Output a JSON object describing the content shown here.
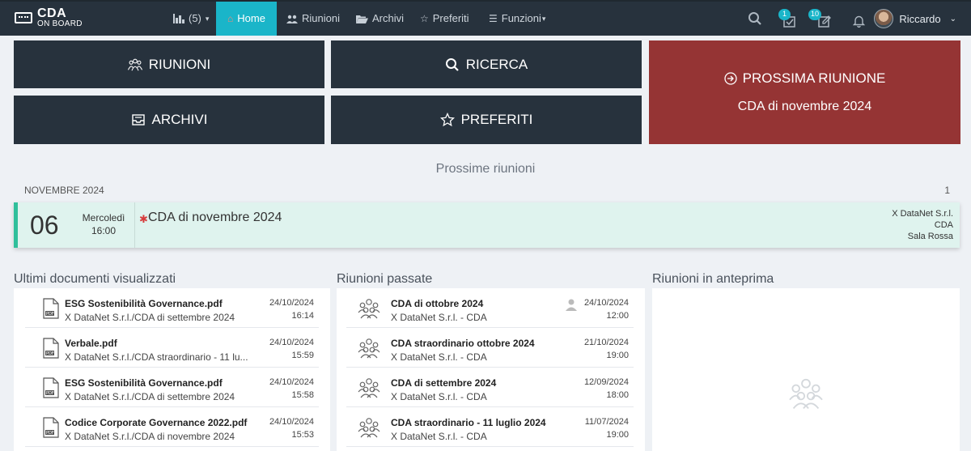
{
  "brand": {
    "line1": "CDA",
    "line2": "ON BOARD"
  },
  "nav": {
    "stats": "(5)",
    "home": "Home",
    "riunioni": "Riunioni",
    "archivi": "Archivi",
    "preferiti": "Preferiti",
    "funzioni": "Funzioni"
  },
  "badges": {
    "tasks": "1",
    "edits": "10"
  },
  "user": {
    "name": "Riccardo"
  },
  "tiles": {
    "riunioni": "RIUNIONI",
    "ricerca": "RICERCA",
    "archivi": "ARCHIVI",
    "preferiti": "PREFERITI",
    "prossima_label": "PROSSIMA RIUNIONE",
    "prossima_name": "CDA di novembre 2024"
  },
  "upcoming": {
    "title": "Prossime riunioni",
    "month": "NOVEMBRE 2024",
    "count": "1",
    "meeting": {
      "day": "06",
      "weekday": "Mercoledì",
      "time": "16:00",
      "title": "CDA di novembre 2024",
      "company": "X DataNet S.r.l.",
      "body": "CDA",
      "room": "Sala Rossa"
    }
  },
  "documents": {
    "title": "Ultimi documenti visualizzati",
    "items": [
      {
        "name": "ESG Sostenibilità Governance.pdf",
        "path": "X DataNet S.r.l./CDA di settembre 2024",
        "date": "24/10/2024",
        "time": "16:14"
      },
      {
        "name": "Verbale.pdf",
        "path": "X DataNet S.r.l./CDA straordinario - 11 lu...",
        "date": "24/10/2024",
        "time": "15:59"
      },
      {
        "name": "ESG Sostenibilità Governance.pdf",
        "path": "X DataNet S.r.l./CDA di settembre 2024",
        "date": "24/10/2024",
        "time": "15:58"
      },
      {
        "name": "Codice Corporate Governance 2022.pdf",
        "path": "X DataNet S.r.l./CDA di novembre 2024",
        "date": "24/10/2024",
        "time": "15:53"
      }
    ]
  },
  "past": {
    "title": "Riunioni passate",
    "items": [
      {
        "name": "CDA di ottobre 2024",
        "org": "X DataNet S.r.l. - CDA",
        "date": "24/10/2024",
        "time": "12:00"
      },
      {
        "name": "CDA straordinario ottobre 2024",
        "org": "X DataNet S.r.l. - CDA",
        "date": "21/10/2024",
        "time": "19:00"
      },
      {
        "name": "CDA di settembre 2024",
        "org": "X DataNet S.r.l. - CDA",
        "date": "12/09/2024",
        "time": "18:00"
      },
      {
        "name": "CDA straordinario - 11 luglio 2024",
        "org": "X DataNet S.r.l. - CDA",
        "date": "11/07/2024",
        "time": "19:00"
      }
    ]
  },
  "preview": {
    "title": "Riunioni in anteprima"
  },
  "colors": {
    "navbar": "#27323d",
    "accent": "#1ab5c9",
    "next_meeting": "#953434",
    "meeting_bg": "#dff3ee"
  }
}
